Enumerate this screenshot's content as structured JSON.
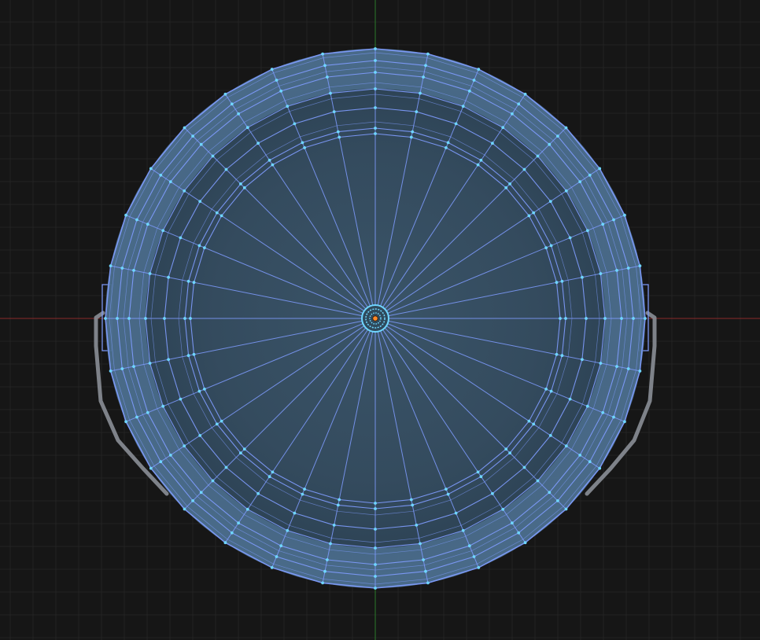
{
  "viewport": {
    "mode": "edit-mesh-top-view",
    "background_color": "#161616",
    "grid": {
      "visible": true,
      "minor_color": "#232323",
      "major_color": "#2b2b2b"
    },
    "axes": {
      "x_axis_color": "#8a2a2a",
      "y_axis_color": "#2a7a2a"
    }
  },
  "mesh": {
    "object": "bucket",
    "view": "top",
    "radial_segments": 32,
    "ring_count": 6,
    "face_color": "#4a6a86",
    "wire_color": "#7f9cff",
    "vertex_color": "#6fd6ff",
    "selected": true
  },
  "handle": {
    "visible": true,
    "color": "#8a8e96"
  },
  "origin": {
    "visible": true,
    "color": "#ff8a2a"
  }
}
